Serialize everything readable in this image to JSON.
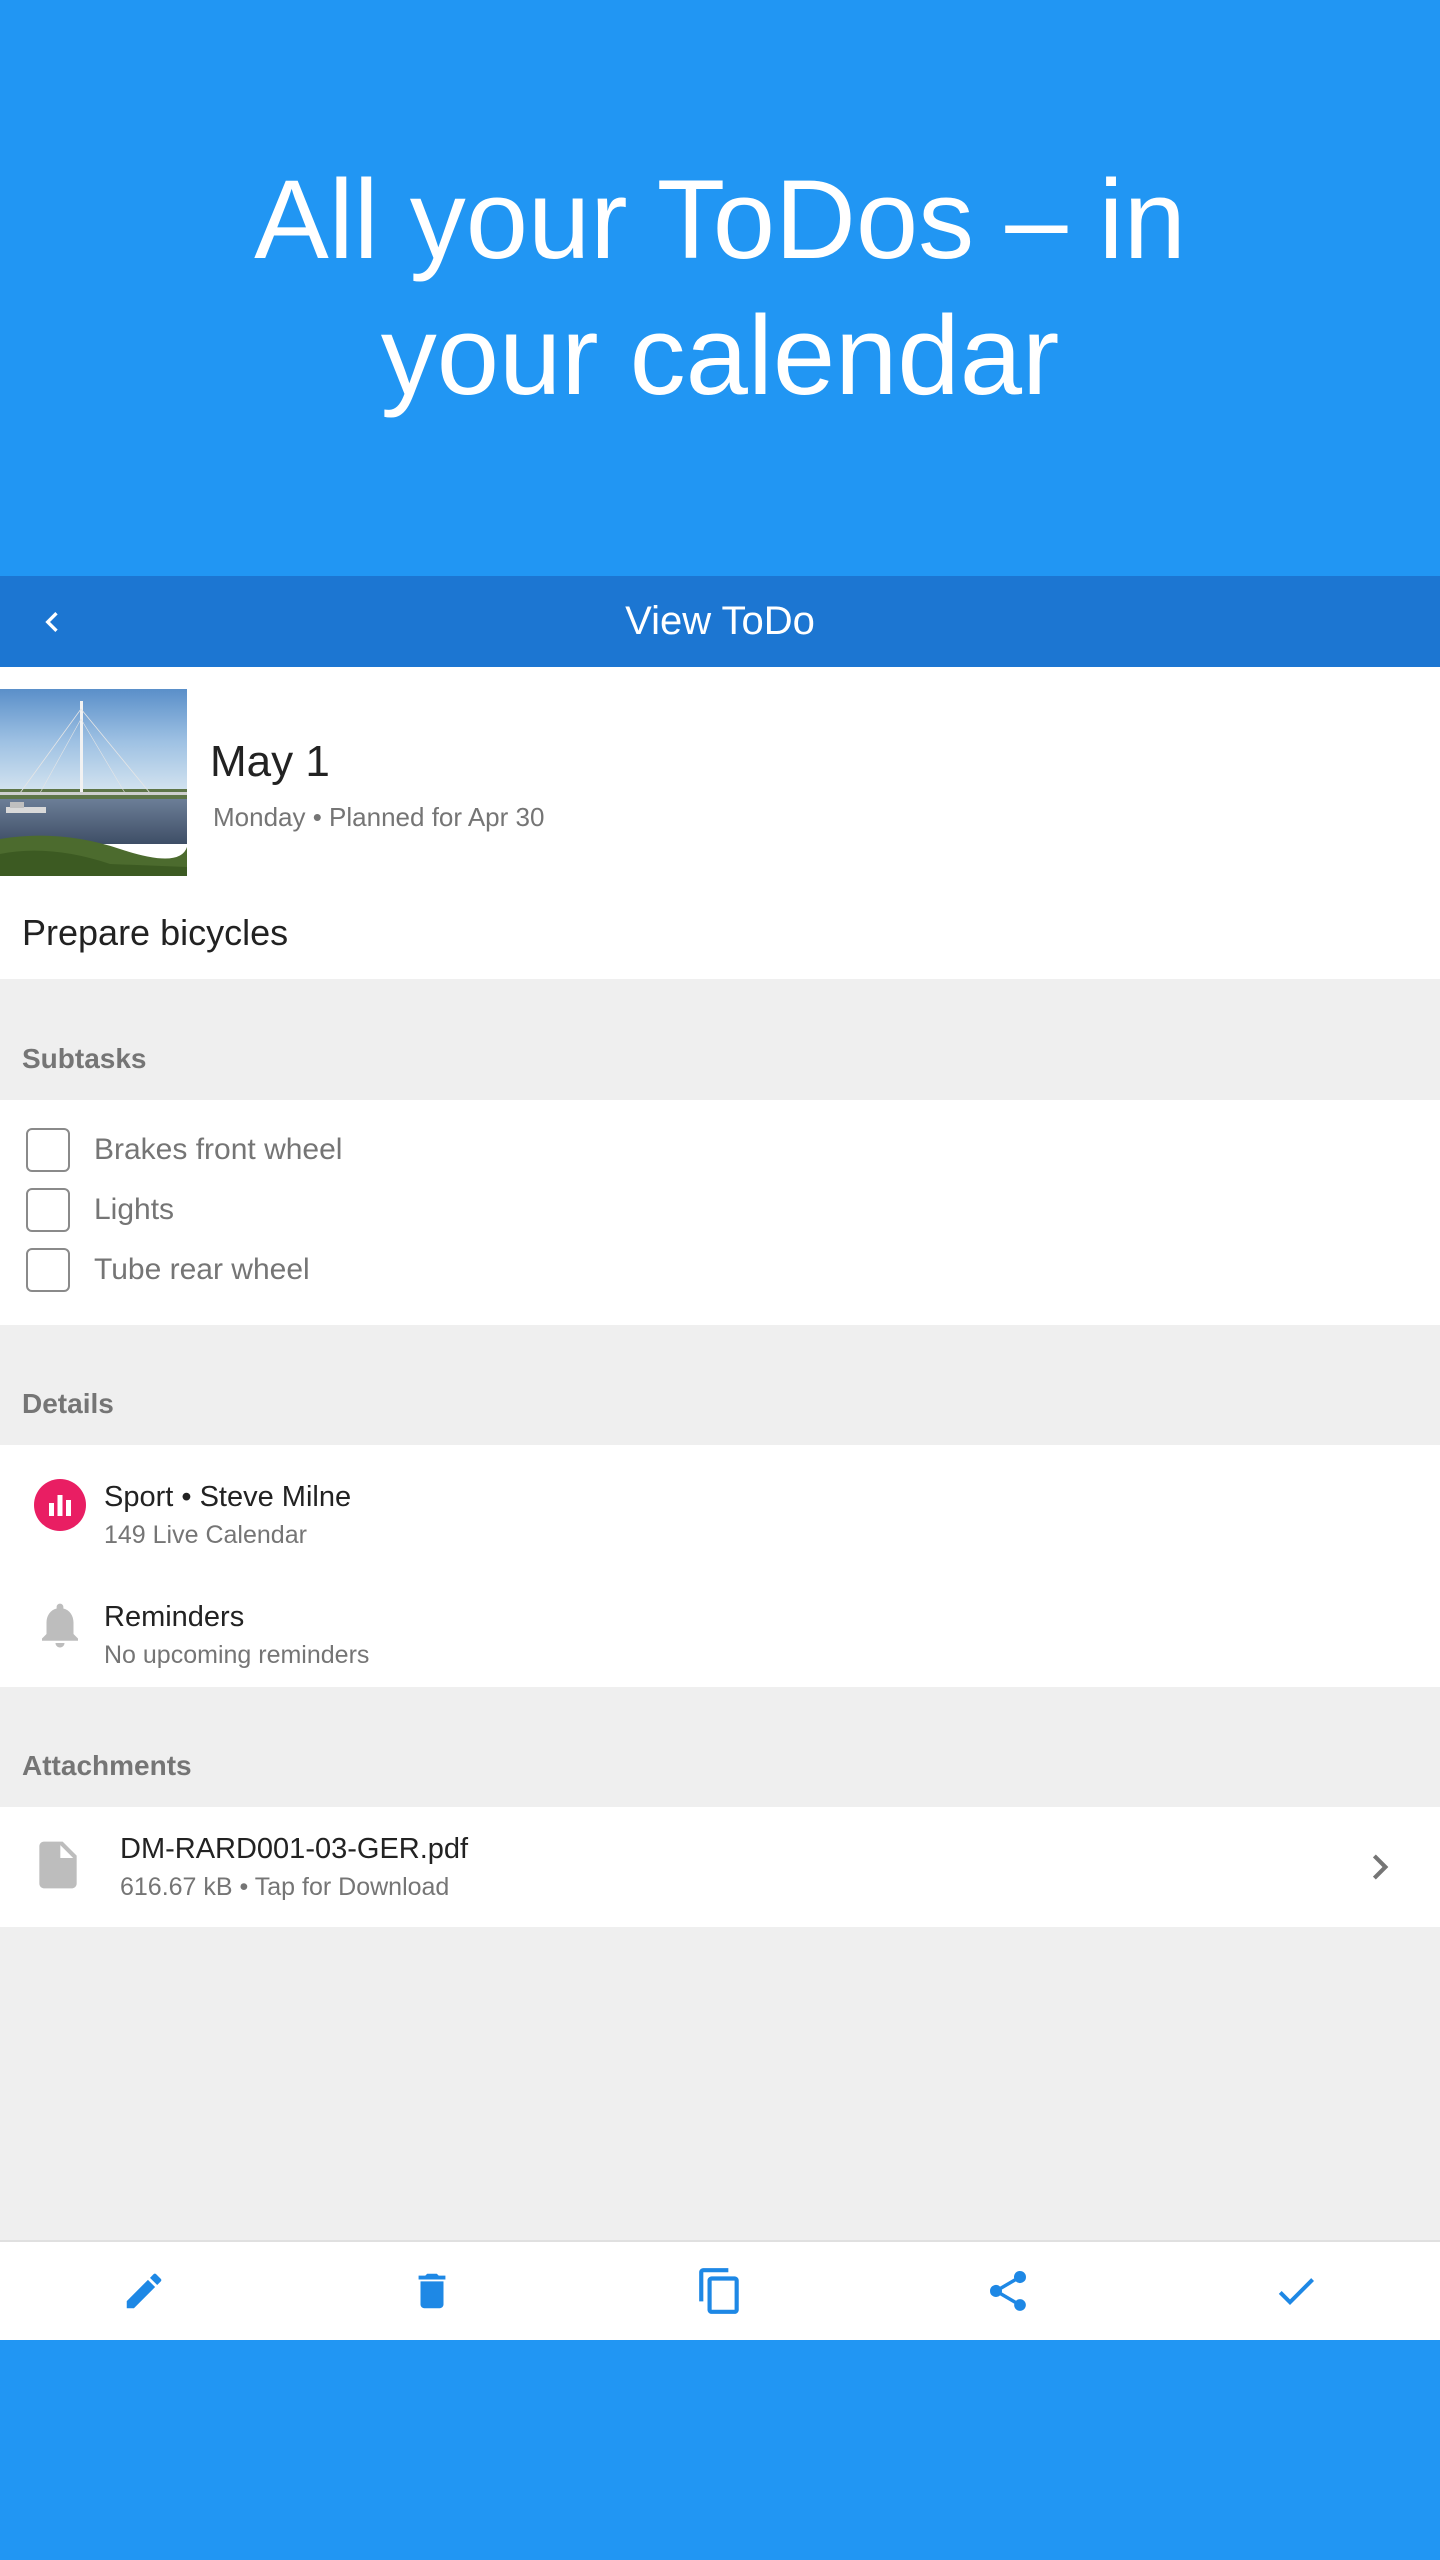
{
  "promo": {
    "title": "All your ToDos – in your calendar"
  },
  "appbar": {
    "title": "View ToDo",
    "back_icon": "chevron-left-icon"
  },
  "todo": {
    "date": "May 1",
    "date_sub": "Monday • Planned for Apr 30",
    "title": "Prepare bicycles"
  },
  "subtasks": {
    "label": "Subtasks",
    "items": [
      {
        "label": "Brakes front wheel",
        "checked": false
      },
      {
        "label": "Lights",
        "checked": false
      },
      {
        "label": "Tube rear wheel",
        "checked": false
      }
    ]
  },
  "details": {
    "label": "Details",
    "calendar": {
      "primary": "Sport • Steve Milne",
      "secondary": "149 Live Calendar",
      "icon": "bar-chart-icon",
      "color": "#E91E63"
    },
    "reminders": {
      "primary": "Reminders",
      "secondary": "No upcoming reminders",
      "icon": "bell-icon"
    }
  },
  "attachments": {
    "label": "Attachments",
    "items": [
      {
        "name": "DM-RARD001-03-GER.pdf",
        "meta": "616.67 kB • Tap for Download",
        "icon": "file-icon"
      }
    ]
  },
  "bottombar": {
    "actions": [
      "edit-icon",
      "delete-icon",
      "copy-icon",
      "share-icon",
      "check-icon"
    ]
  },
  "colors": {
    "primary": "#2196F3",
    "appbar": "#1C76D2",
    "accent": "#1E88E5"
  }
}
